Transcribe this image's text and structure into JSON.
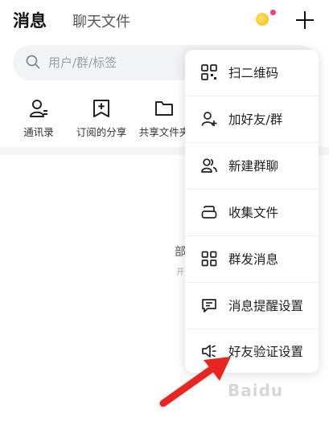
{
  "header": {
    "tab_messages": "消息",
    "tab_chat_files": "聊天文件"
  },
  "search": {
    "placeholder": "用户/群/标签"
  },
  "quick_actions": [
    {
      "label": "通讯录",
      "icon": "contacts-icon"
    },
    {
      "label": "订阅的分享",
      "icon": "subscribed-share-icon"
    },
    {
      "label": "共享文件夹",
      "icon": "shared-folder-icon"
    }
  ],
  "background": {
    "fragment_1": "部",
    "fragment_2": "开"
  },
  "menu": {
    "items": [
      {
        "label": "扫二维码",
        "icon": "qr-code-icon"
      },
      {
        "label": "加好友/群",
        "icon": "add-friend-icon"
      },
      {
        "label": "新建群聊",
        "icon": "new-group-icon"
      },
      {
        "label": "收集文件",
        "icon": "collect-files-icon"
      },
      {
        "label": "群发消息",
        "icon": "broadcast-grid-icon"
      },
      {
        "label": "消息提醒设置",
        "icon": "message-alert-icon"
      },
      {
        "label": "好友验证设置",
        "icon": "speaker-icon"
      }
    ]
  },
  "annotation": {
    "arrow_color": "#e8261f"
  },
  "watermark": {
    "text": "Baidu"
  },
  "colors": {
    "coin": "#f2b705",
    "notification_dot": "#ff3b6b",
    "search_bg": "#f2f3f5"
  }
}
